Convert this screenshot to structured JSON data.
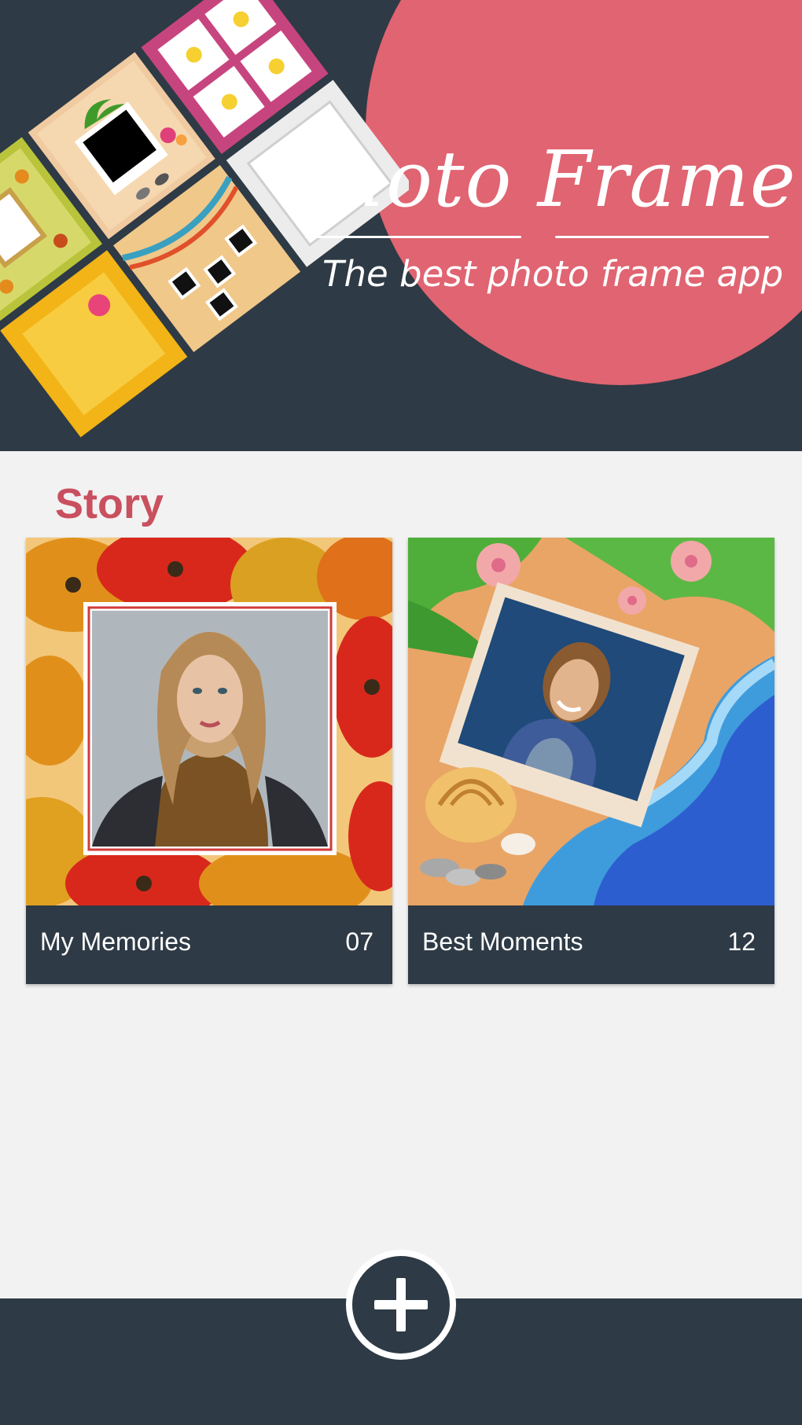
{
  "header": {
    "app_title": "Photo Frame",
    "app_subtitle": "The best photo frame app"
  },
  "story": {
    "section_title": "Story",
    "albums": [
      {
        "name": "My Memories",
        "count": "07"
      },
      {
        "name": "Best Moments",
        "count": "12"
      }
    ]
  },
  "actions": {
    "add_icon": "plus-icon"
  },
  "colors": {
    "header_bg": "#2e3a45",
    "accent": "#e06471",
    "section_title": "#c9505f",
    "page_bg": "#f2f2f2"
  }
}
